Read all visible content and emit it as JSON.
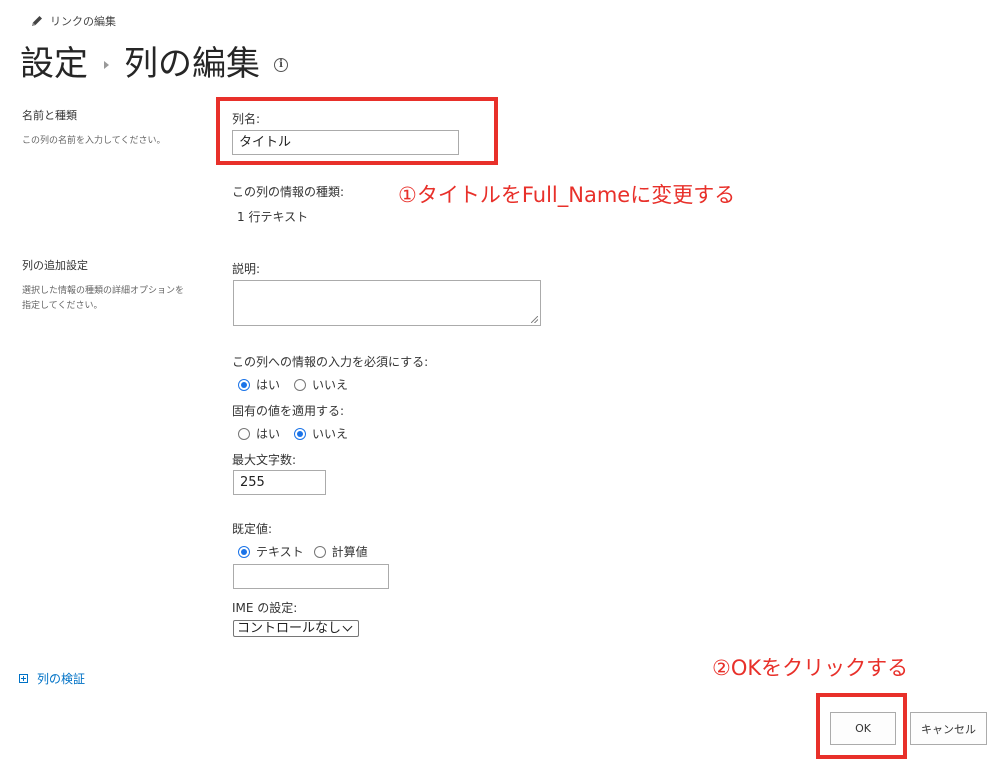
{
  "header": {
    "edit_links": "リンクの編集",
    "breadcrumb_root": "設定",
    "page_title": "列の編集"
  },
  "sections": {
    "name_type": {
      "title": "名前と種類",
      "description": "この列の名前を入力してください。"
    },
    "additional": {
      "title": "列の追加設定",
      "description_line1": "選択した情報の種類の詳細オプションを",
      "description_line2": "指定してください。"
    }
  },
  "fields": {
    "column_name_label": "列名:",
    "column_name_value": "タイトル",
    "info_type_label": "この列の情報の種類:",
    "info_type_value": "1 行テキスト",
    "description_label": "説明:",
    "required_label": "この列への情報の入力を必須にする:",
    "required_yes": "はい",
    "required_no": "いいえ",
    "required_selected": "yes",
    "unique_label": "固有の値を適用する:",
    "unique_yes": "はい",
    "unique_no": "いいえ",
    "unique_selected": "no",
    "max_chars_label": "最大文字数:",
    "max_chars_value": "255",
    "default_label": "既定値:",
    "default_text": "テキスト",
    "default_calculated": "計算値",
    "default_selected": "text",
    "ime_label": "IME の設定:",
    "ime_value": "コントロールなし"
  },
  "validation": {
    "label": "列の検証"
  },
  "buttons": {
    "ok": "OK",
    "cancel": "キャンセル"
  },
  "annotations": {
    "step1": "①タイトルをFull_Nameに変更する",
    "step2": "②OKをクリックする",
    "color": "#e8302a"
  },
  "icons": {
    "pencil": "pencil-icon",
    "info": "info-icon",
    "expand": "plus-box-icon"
  },
  "colors": {
    "link": "#0072c6",
    "radio_selected": "#1a73e8"
  }
}
